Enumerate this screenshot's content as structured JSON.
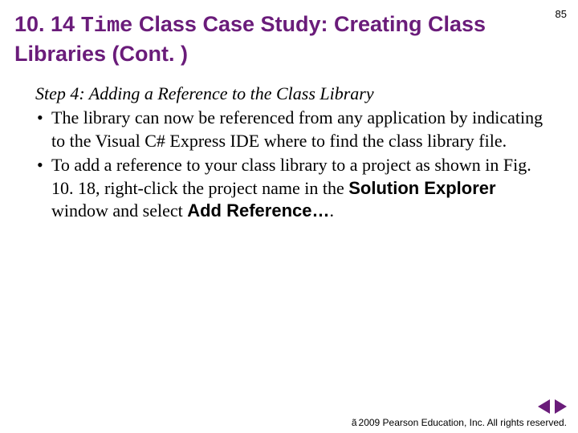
{
  "page_number": "85",
  "heading": {
    "section_number": "10. 14 ",
    "time_word": "Time",
    "rest": " Class Case Study: Creating Class Libraries (Cont. )"
  },
  "body": {
    "step_title": "Step 4: Adding a Reference to the Class Library",
    "bullet1": "The library can now be referenced from any application by indicating to the Visual C# Express IDE where to find the class library file.",
    "bullet2_pre": "To add a reference to your class library to a project as shown in Fig. 10. 18, right-click the project name in the ",
    "bullet2_solution_explorer": "Solution Explorer",
    "bullet2_mid": " window and select ",
    "bullet2_add_reference": "Add Reference…",
    "bullet2_post": "."
  },
  "footer": {
    "copyright_symbol": "ã",
    "copyright_text": " 2009 Pearson Education, Inc.  All rights reserved."
  },
  "nav": {
    "prev": "previous-slide",
    "next": "next-slide"
  }
}
